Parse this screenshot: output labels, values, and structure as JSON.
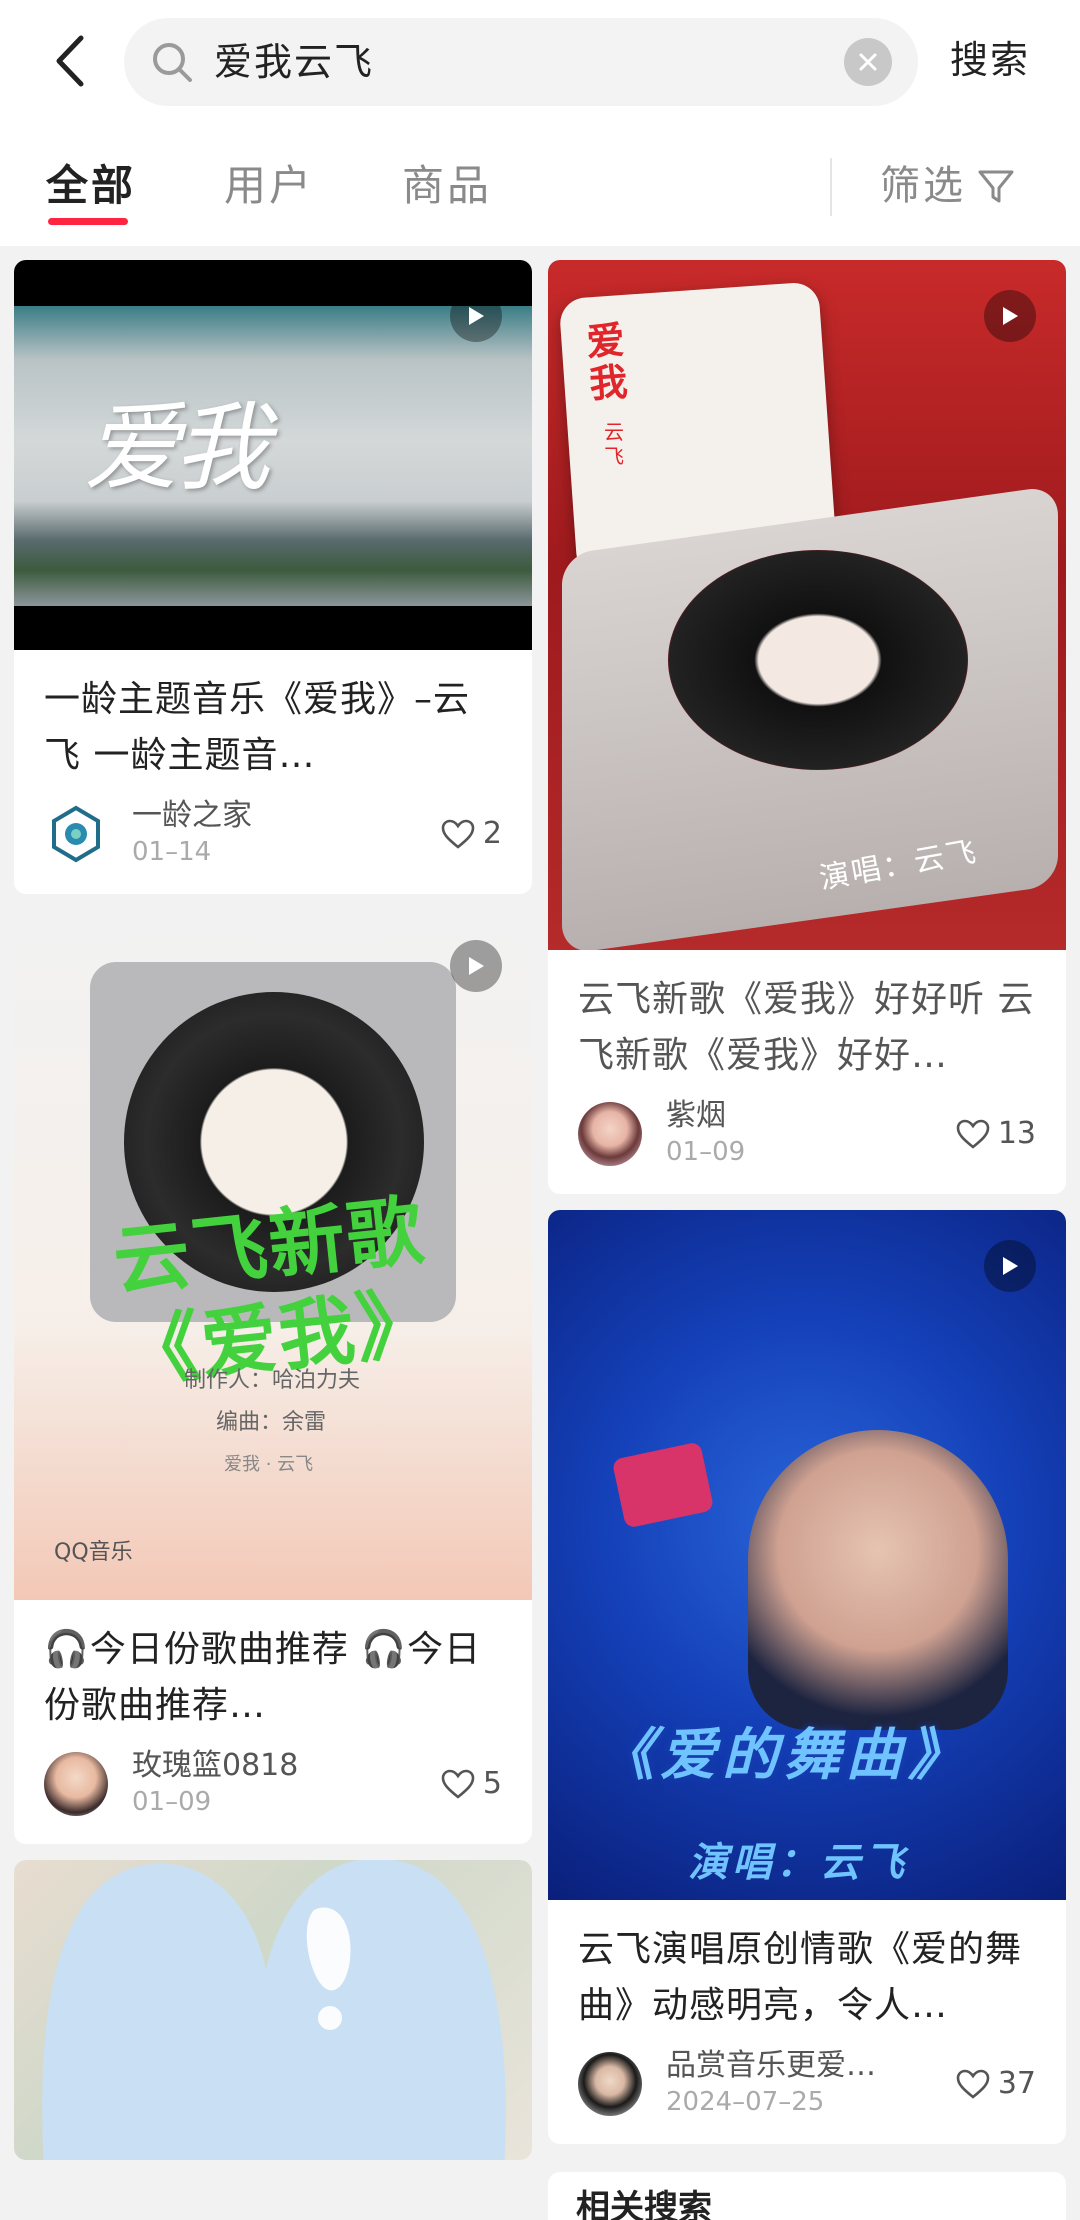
{
  "header": {
    "search_query": "爱我云飞",
    "search_button": "搜索",
    "back_icon": "back-arrow-icon",
    "clear_icon": "clear-icon"
  },
  "tabs": [
    {
      "label": "全部",
      "active": true
    },
    {
      "label": "用户",
      "active": false
    },
    {
      "label": "商品",
      "active": false
    }
  ],
  "filter": {
    "label": "筛选",
    "icon": "filter-icon"
  },
  "accent_color": "#ff2442",
  "feed": {
    "left": [
      {
        "type": "video",
        "thumb_text": "爱我",
        "title": "一龄主题音乐《爱我》–云飞 一龄主题音…",
        "author": "一龄之家",
        "date": "01–14",
        "likes": "2"
      },
      {
        "type": "video",
        "thumb_text": "云飞新歌《爱我》",
        "thumb_credit_1": "制作人：哈泊力夫",
        "thumb_credit_2": "编曲：余雷",
        "thumb_credit_3": "爱我 · 云飞",
        "thumb_brand": "QQ音乐",
        "title": "🎧今日份歌曲推荐 🎧今日份歌曲推荐…",
        "author": "玫瑰篮0818",
        "date": "01–09",
        "likes": "5"
      },
      {
        "type": "image",
        "title": "",
        "author": "",
        "date": "",
        "likes": ""
      }
    ],
    "right": [
      {
        "type": "video",
        "thumb_text_1": "爱我",
        "thumb_text_2": "云飞",
        "thumb_text_3": "演唱：云飞",
        "title": "云飞新歌《爱我》好好听 云飞新歌《爱我》好好…",
        "author": "紫烟",
        "date": "01–09",
        "likes": "13"
      },
      {
        "type": "video",
        "thumb_text_1": "《爱的舞曲》",
        "thumb_text_2": "演唱：云飞",
        "title": "云飞演唱原创情歌《爱的舞曲》动感明亮，令人…",
        "author": "品赏音乐更爱…",
        "date": "2024–07–25",
        "likes": "37"
      }
    ]
  },
  "related": {
    "label": "相关搜索"
  }
}
